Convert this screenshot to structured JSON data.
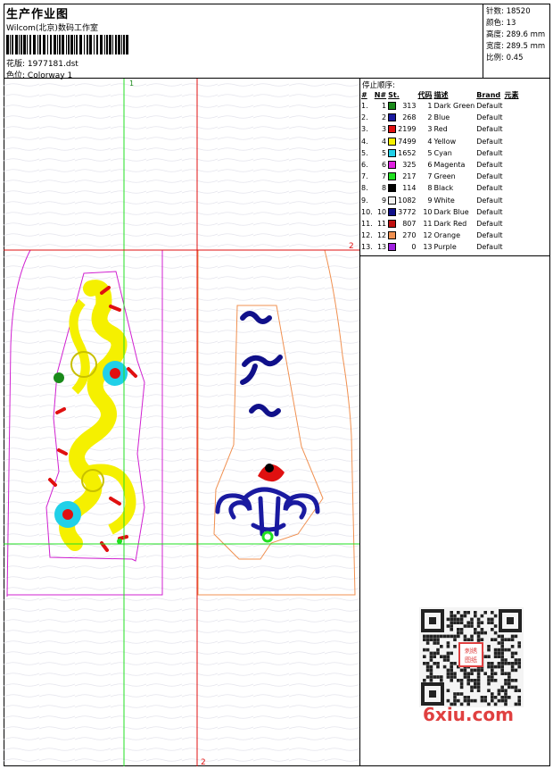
{
  "header": {
    "title": "生产作业图",
    "company": "Wilcom(北京)数码工作室",
    "design_label": "花版:",
    "design_value": "1977181.dst",
    "colorway_label": "色位:",
    "colorway_value": "Colorway 1"
  },
  "stats": {
    "stitches": "针数: 18520",
    "colors": "颜色: 13",
    "height": "高度: 289.6 mm",
    "width": "宽度: 289.5 mm",
    "scale": "比例: 0.45"
  },
  "guides": {
    "green_label": "1",
    "red_h_label": "2",
    "red_v_label": "2"
  },
  "stop_sequence": {
    "label": "停止顺序:",
    "columns": [
      "#",
      "N#",
      "St.",
      "代码",
      "描述",
      "Brand",
      "元素"
    ],
    "rows": [
      {
        "idx": "1.",
        "n": "1",
        "color": "#1a8a1a",
        "st": "313",
        "code": "1",
        "desc": "Dark Green",
        "brand": "Default"
      },
      {
        "idx": "2.",
        "n": "2",
        "color": "#1a1aa0",
        "st": "268",
        "code": "2",
        "desc": "Blue",
        "brand": "Default"
      },
      {
        "idx": "3.",
        "n": "3",
        "color": "#e01010",
        "st": "2199",
        "code": "3",
        "desc": "Red",
        "brand": "Default"
      },
      {
        "idx": "4.",
        "n": "4",
        "color": "#f5f000",
        "st": "7499",
        "code": "4",
        "desc": "Yellow",
        "brand": "Default"
      },
      {
        "idx": "5.",
        "n": "5",
        "color": "#20d0e8",
        "st": "1652",
        "code": "5",
        "desc": "Cyan",
        "brand": "Default"
      },
      {
        "idx": "6.",
        "n": "6",
        "color": "#e020e0",
        "st": "325",
        "code": "6",
        "desc": "Magenta",
        "brand": "Default"
      },
      {
        "idx": "7.",
        "n": "7",
        "color": "#20e020",
        "st": "217",
        "code": "7",
        "desc": "Green",
        "brand": "Default"
      },
      {
        "idx": "8.",
        "n": "8",
        "color": "#000000",
        "st": "114",
        "code": "8",
        "desc": "Black",
        "brand": "Default"
      },
      {
        "idx": "9.",
        "n": "9",
        "color": "#f0f0f0",
        "st": "1082",
        "code": "9",
        "desc": "White",
        "brand": "Default"
      },
      {
        "idx": "10.",
        "n": "10",
        "color": "#10108a",
        "st": "3772",
        "code": "10",
        "desc": "Dark Blue",
        "brand": "Default"
      },
      {
        "idx": "11.",
        "n": "11",
        "color": "#c01010",
        "st": "807",
        "code": "11",
        "desc": "Dark Red",
        "brand": "Default"
      },
      {
        "idx": "12.",
        "n": "12",
        "color": "#f09050",
        "st": "270",
        "code": "12",
        "desc": "Orange",
        "brand": "Default"
      },
      {
        "idx": "13.",
        "n": "13",
        "color": "#a020e0",
        "st": "0",
        "code": "13",
        "desc": "Purple",
        "brand": "Default"
      }
    ]
  },
  "watermark": {
    "qr_badge": "刺绣图纸",
    "site": "6xiu.com"
  }
}
